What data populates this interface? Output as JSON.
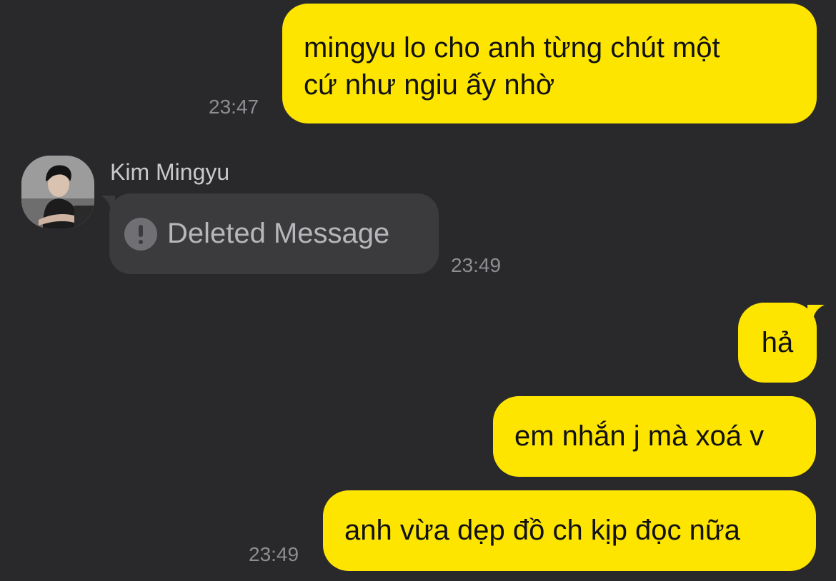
{
  "messages": [
    {
      "direction": "outgoing",
      "lines": [
        "mingyu lo cho anh từng chút một",
        "cứ như ngiu ấy nhờ"
      ],
      "time": "23:47"
    },
    {
      "direction": "incoming",
      "sender": "Kim Mingyu",
      "text": "Deleted Message",
      "icon": "exclamation-circle-icon",
      "time": "23:49"
    },
    {
      "direction": "outgoing",
      "text": "hả"
    },
    {
      "direction": "outgoing",
      "text": "em nhắn j mà xoá v"
    },
    {
      "direction": "outgoing",
      "text": "anh vừa dẹp đồ ch kịp đọc nữa",
      "time": "23:49"
    }
  ],
  "colors": {
    "background": "#29292b",
    "outgoing_bubble": "#fee500",
    "incoming_bubble": "#3b3b3d",
    "timestamp": "#8d8d92"
  }
}
